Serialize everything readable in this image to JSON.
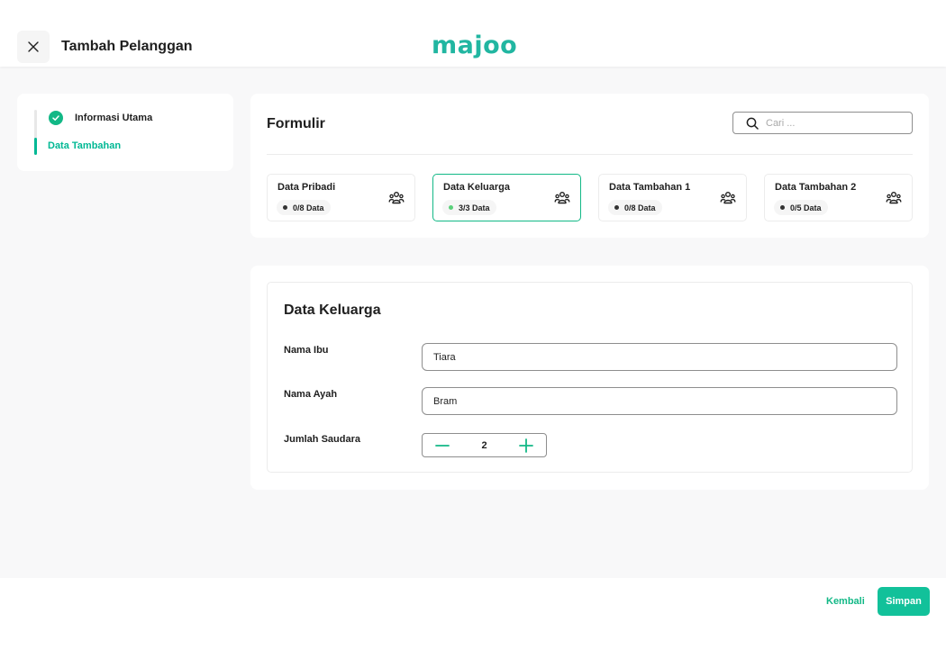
{
  "header": {
    "title": "Tambah Pelanggan",
    "logo_text": "majoo",
    "logo_color": "#21b6a1"
  },
  "sidebar": {
    "steps": [
      {
        "label": "Informasi Utama",
        "status": "done",
        "icon": "check-circle-icon"
      },
      {
        "label": "Data Tambahan",
        "status": "active"
      }
    ]
  },
  "form": {
    "title": "Formulir",
    "search_placeholder": "Cari ...",
    "tabs": [
      {
        "name": "Data Pribadi",
        "badge": "0/8 Data",
        "active": false,
        "icon": "users-group-icon"
      },
      {
        "name": "Data Keluarga",
        "badge": "3/3 Data",
        "active": true,
        "icon": "users-group-icon"
      },
      {
        "name": "Data Tambahan 1",
        "badge": "0/8 Data",
        "active": false,
        "icon": "users-group-icon"
      },
      {
        "name": "Data Tambahan 2",
        "badge": "0/5 Data",
        "active": false,
        "icon": "users-group-icon"
      }
    ]
  },
  "detail": {
    "title": "Data Keluarga",
    "fields": {
      "ibu": {
        "label": "Nama Ibu",
        "value": "Tiara"
      },
      "ayah": {
        "label": "Nama Ayah",
        "value": "Bram"
      },
      "saudara": {
        "label": "Jumlah Saudara",
        "value": "2"
      }
    }
  },
  "footer": {
    "back_label": "Kembali",
    "save_label": "Simpan"
  },
  "colors": {
    "accent": "#12b886",
    "save_button": "#12c19a"
  }
}
